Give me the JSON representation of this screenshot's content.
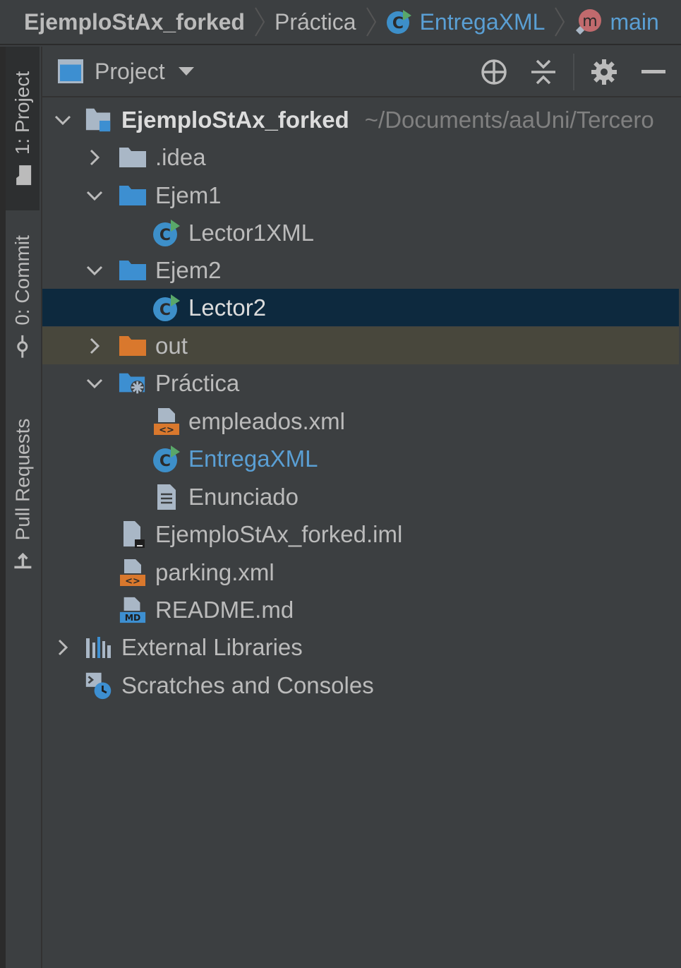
{
  "breadcrumb": {
    "project": "EjemploStAx_forked",
    "folder": "Práctica",
    "file": "EntregaXML",
    "method": "main"
  },
  "toolstrip": {
    "project_tab": "1: Project",
    "commit_tab": "0: Commit",
    "pull_requests_tab": "Pull Requests"
  },
  "panel": {
    "title": "Project",
    "buttons": [
      "locate-icon",
      "collapse-all-icon",
      "gear-icon",
      "hide-icon"
    ]
  },
  "tree": {
    "root": {
      "label": "EjemploStAx_forked",
      "path": "~/Documents/aaUni/Tercero"
    },
    "items": [
      {
        "label": ".idea",
        "icon": "folder-icon",
        "expanded": false
      },
      {
        "label": "Ejem1",
        "icon": "folder-icon",
        "expanded": true
      },
      {
        "label": "Lector1XML",
        "icon": "java-class-icon"
      },
      {
        "label": "Ejem2",
        "icon": "folder-icon",
        "expanded": true
      },
      {
        "label": "Lector2",
        "icon": "java-class-icon",
        "selected": true
      },
      {
        "label": "out",
        "icon": "folder-icon",
        "expanded": false,
        "excluded": true
      },
      {
        "label": "Práctica",
        "icon": "package-folder-icon",
        "expanded": true
      },
      {
        "label": "empleados.xml",
        "icon": "xml-file-icon"
      },
      {
        "label": "EntregaXML",
        "icon": "java-class-icon",
        "modified": true
      },
      {
        "label": "Enunciado",
        "icon": "text-file-icon"
      },
      {
        "label": "EjemploStAx_forked.iml",
        "icon": "iml-file-icon"
      },
      {
        "label": "parking.xml",
        "icon": "xml-file-icon"
      },
      {
        "label": "README.md",
        "icon": "markdown-file-icon"
      },
      {
        "label": "External Libraries",
        "icon": "libraries-icon",
        "expanded": false
      },
      {
        "label": "Scratches and Consoles",
        "icon": "scratches-icon"
      }
    ]
  },
  "colors": {
    "background": "#3c3f41",
    "selection": "#0d293e",
    "excluded_highlight": "#48473c",
    "folder_blue": "#3d8fd1",
    "folder_orange": "#d9782d",
    "modified_blue": "#5a9fd4"
  }
}
